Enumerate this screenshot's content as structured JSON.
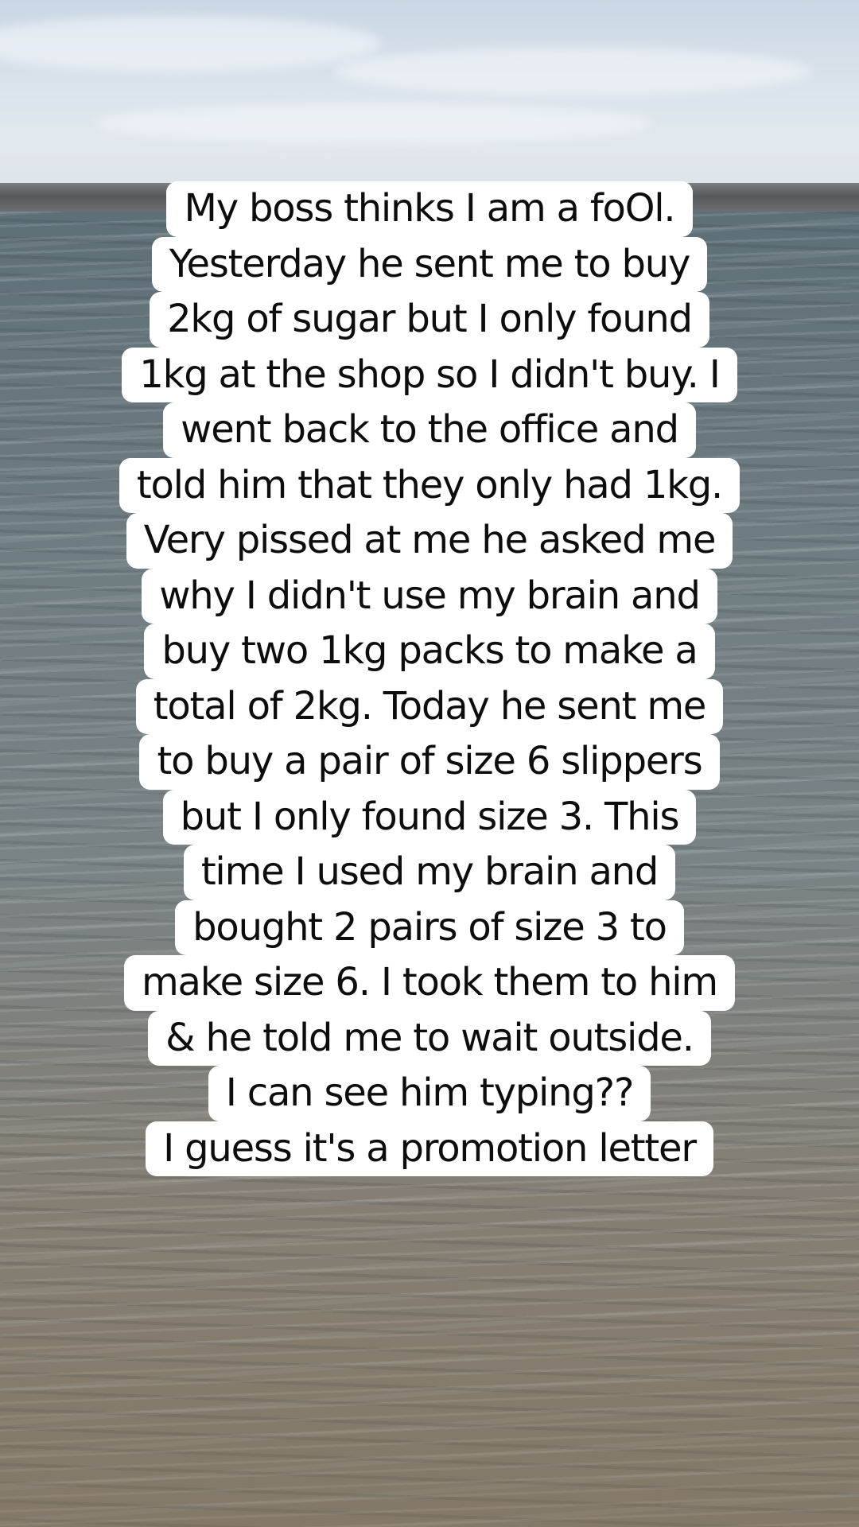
{
  "caption": {
    "lines": [
      "My boss thinks I am a foOl.",
      "Yesterday he sent me to buy",
      "2kg of sugar but I only found",
      "1kg at the shop so I didn't buy. I",
      "went back to the office and",
      "told him that they only had 1kg.",
      "Very pissed at me he asked me",
      "why I didn't use my brain and",
      "buy two 1kg packs to make a",
      "total of 2kg. Today he sent me",
      "to buy a pair of size 6 slippers",
      "but I only found size 3. This",
      "time I used my brain and",
      "bought 2 pairs of size 3 to",
      "make size 6. I took them to him",
      "& he told me to wait outside.",
      "I can see him typing??",
      "I guess it's a promotion letter"
    ]
  },
  "colors": {
    "caption_bg": "#ffffff",
    "caption_text": "#0d0d0d",
    "sky": "#d7e1ea",
    "sea": "#6f7d82"
  }
}
